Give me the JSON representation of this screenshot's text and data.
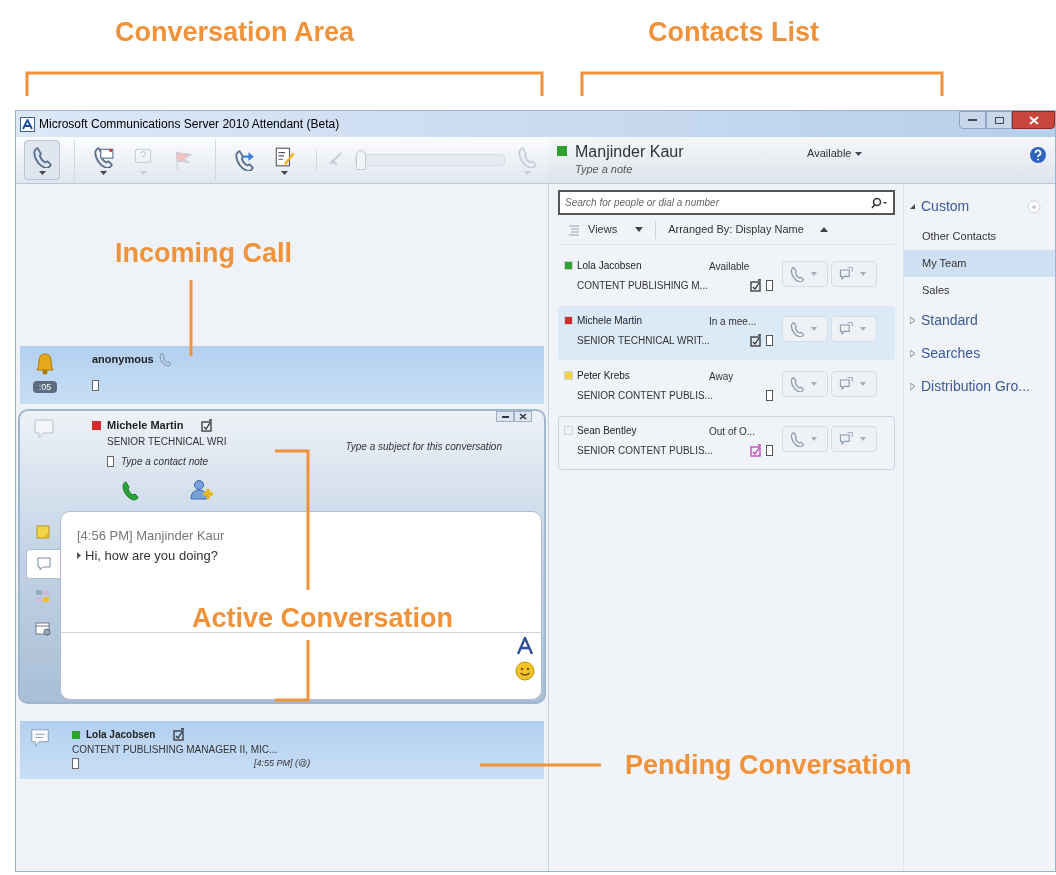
{
  "annotations": [
    {
      "label": "Conversation Area"
    },
    {
      "label": "Contacts List"
    },
    {
      "label": "Incoming Call"
    },
    {
      "label": "Active Conversation"
    },
    {
      "label": "Pending Conversation"
    }
  ],
  "window": {
    "title": "Microsoft Communications Server 2010 Attendant (Beta)"
  },
  "toolbar": [
    {
      "kind": "phone",
      "disabled": false,
      "dropdown": true
    },
    {
      "kind": "voicemail",
      "disabled": false,
      "dropdown": true
    },
    {
      "kind": "question",
      "disabled": true,
      "dropdown": true
    },
    {
      "kind": "flag",
      "disabled": true,
      "dropdown": false
    },
    {
      "kind": "transfer",
      "disabled": false,
      "dropdown": false
    },
    {
      "kind": "notes",
      "disabled": false,
      "dropdown": true
    },
    {
      "kind": "volume",
      "disabled": true,
      "level": 0.0
    },
    {
      "kind": "phone",
      "disabled": true,
      "dropdown": true
    }
  ],
  "me": {
    "name": "Manjinder Kaur",
    "color": "#2ea32e",
    "note_placeholder": "Type a note",
    "status": "Available"
  },
  "search": {
    "placeholder": "Search for people or dial a number"
  },
  "views": {
    "label": "Views",
    "arranged": "Arranged By: Display Name"
  },
  "contacts": [
    {
      "name": "Lola Jacobsen",
      "color": "#2ea32e",
      "status": "Available",
      "title": "CONTENT PUBLISHING M...",
      "note": true,
      "note_new": false,
      "selected": false,
      "focused": false
    },
    {
      "name": "Michele Martin",
      "color": "#d42a2a",
      "status": "In a mee...",
      "title": "SENIOR TECHNICAL WRIT...",
      "note": true,
      "note_new": false,
      "selected": true,
      "focused": false
    },
    {
      "name": "Peter Krebs",
      "color": "#f5d24a",
      "status": "Away",
      "title": "SENIOR CONTENT PUBLIS...",
      "note": false,
      "selected": false,
      "focused": false
    },
    {
      "name": "Sean Bentley",
      "color": "#f2f2f2",
      "status": "Out of O...",
      "title": "SENIOR CONTENT PUBLIS...",
      "note": true,
      "note_new": true,
      "selected": false,
      "focused": true
    }
  ],
  "groups": [
    {
      "label": "Custom",
      "expanded": true,
      "children": [
        {
          "label": "Other Contacts",
          "selected": false
        },
        {
          "label": "My Team",
          "selected": true
        },
        {
          "label": "Sales",
          "selected": false
        }
      ]
    },
    {
      "label": "Standard",
      "expanded": false
    },
    {
      "label": "Searches",
      "expanded": false
    },
    {
      "label": "Distribution Gro...",
      "expanded": false
    }
  ],
  "incoming_call": {
    "caller": "anonymous",
    "timer": ":05"
  },
  "active_conversation": {
    "name": "Michele Martin",
    "color": "#d42a2a",
    "title": "SENIOR TECHNICAL WRI",
    "note_placeholder": "Type a contact note",
    "subject_placeholder": "Type a subject for this conversation",
    "messages": [
      {
        "header": "[4:56 PM] Manjinder Kaur",
        "text": "Hi, how are you doing?"
      }
    ],
    "side_tabs": [
      {
        "kind": "note",
        "selected": false
      },
      {
        "kind": "chat",
        "selected": true
      },
      {
        "kind": "contacts",
        "selected": false
      },
      {
        "kind": "calendar",
        "selected": false
      }
    ]
  },
  "pending_conversation": {
    "name": "Lola Jacobsen",
    "color": "#2ea32e",
    "title": "CONTENT PUBLISHING MANAGER II, MIC...",
    "time": "[4:55 PM] (@)"
  }
}
